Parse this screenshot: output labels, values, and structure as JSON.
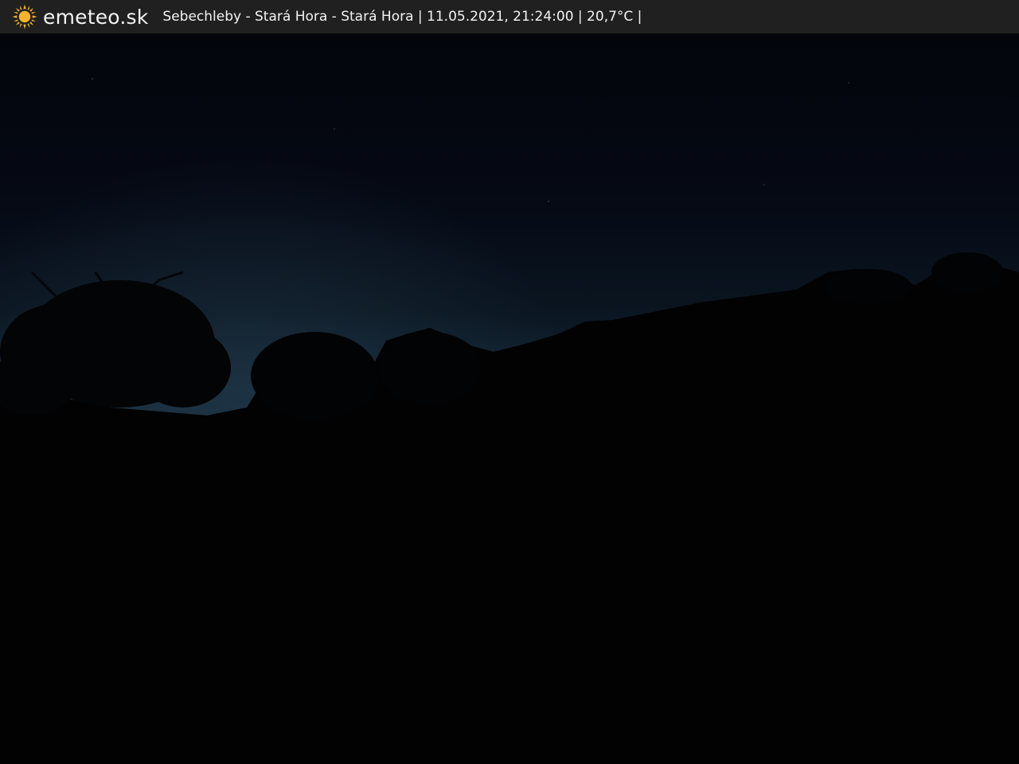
{
  "overlay": {
    "brand": "emeteo.sk",
    "caption": "Sebechleby - Stará Hora - Stará Hora | 11.05.2021, 21:24:00 | 20,7°C |",
    "logo_icon": "sun-icon"
  },
  "colors": {
    "bar_bg": "#202020",
    "text": "#f3f3f3",
    "sun": "#f5b22e",
    "sky_top": "#04060d",
    "sky_horizon": "#14293a",
    "silhouette": "#020203"
  }
}
